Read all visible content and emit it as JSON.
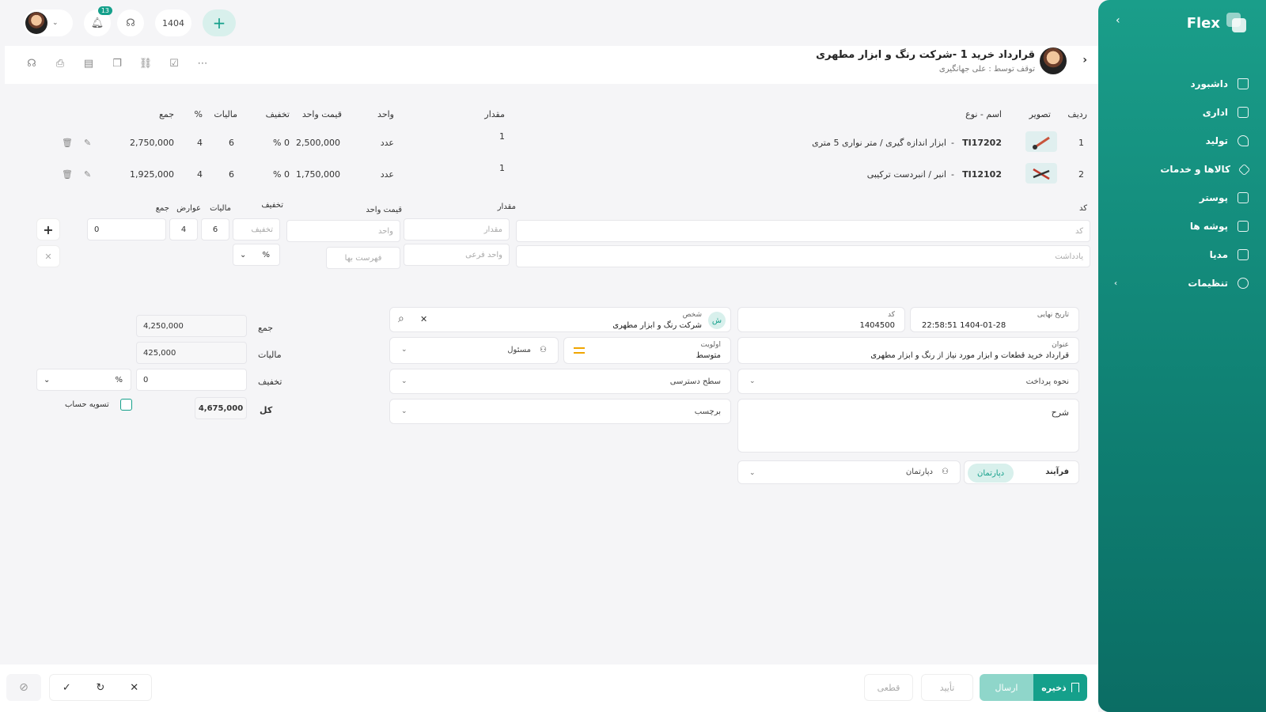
{
  "sidebar": {
    "brand": "Flex",
    "items": [
      {
        "label": "داشبورد"
      },
      {
        "label": "اداری"
      },
      {
        "label": "تولید"
      },
      {
        "label": "کالاها و خدمات"
      },
      {
        "label": "پوستر"
      },
      {
        "label": "پوشه ها"
      },
      {
        "label": "مدیا"
      },
      {
        "label": "تنظیمات"
      }
    ]
  },
  "topbar": {
    "notifications": "13",
    "year": "1404"
  },
  "header": {
    "title": "قرارداد خرید 1 -شرکت رنگ و ابزار مطهری",
    "subtitle": "توقف توسط : علی جهانگیری"
  },
  "table": {
    "headers": {
      "row": "ردیف",
      "image": "تصویر",
      "name": "اسم - نوع",
      "qty": "مقدار",
      "unit": "واحد",
      "price": "قیمت واحد",
      "discount": "تخفیف",
      "tax": "مالیات",
      "pct": "%",
      "total": "جمع"
    },
    "rows": [
      {
        "idx": "1",
        "code": "TI17202",
        "name": "ابزار اندازه گیری / متر نواری 5 متری",
        "qty": "1",
        "unit": "عدد",
        "price": "2,500,000",
        "discount": "0 %",
        "tax": "6",
        "pct": "4",
        "total": "2,750,000"
      },
      {
        "idx": "2",
        "code": "TI12102",
        "name": "انبر / انبردست ترکیبی",
        "qty": "1",
        "unit": "عدد",
        "price": "1,750,000",
        "discount": "0 %",
        "tax": "6",
        "pct": "4",
        "total": "1,925,000"
      }
    ]
  },
  "entry": {
    "code_label": "کد",
    "qty_label": "مقدار",
    "price_label": "قیمت واحد",
    "discount_label": "تخفیف",
    "tax_label": "مالیات",
    "duties_label": "عوارض",
    "total_label": "جمع",
    "code_ph": "کد",
    "note_ph": "یادداشت",
    "qty_ph": "مقدار",
    "subunit_ph": "واحد فرعی",
    "unit_ph": "واحد",
    "pricelist_ph": "فهرست بها",
    "discount_ph": "تخفیف",
    "pct_select": "%",
    "tax_value": "6",
    "duties_value": "4",
    "total_value": "0"
  },
  "form": {
    "deadline_label": "تاریخ نهایی",
    "deadline_value": "1404-01-28 22:58:51",
    "code_label": "کد",
    "code_value": "1404500",
    "person_label": "شخص",
    "person_value": "شرکت رنگ و ابزار مطهری",
    "person_initial": "ش",
    "subject_label": "عنوان",
    "subject_value": "قرارداد خرید قطعات و ابزار مورد نیاز از رنگ و ابزار مطهری",
    "priority_label": "اولویت",
    "priority_value": "متوسط",
    "owner_ph": "مسئول",
    "payment_ph": "نحوه پرداخت",
    "access_ph": "سطح دسترسی",
    "desc_label": "شرح",
    "tag_ph": "برچسب",
    "process_label": "فرآیند",
    "dept_chip": "دپارتمان",
    "dept_ph": "دپارتمان"
  },
  "summary": {
    "sum_label": "جمع",
    "sum_value": "4,250,000",
    "tax_label": "مالیات",
    "tax_value": "425,000",
    "discount_label": "تخفیف",
    "discount_value": "0",
    "discount_unit": "%",
    "total_label": "کل",
    "total_value": "4,675,000",
    "settle_label": "تسویه حساب"
  },
  "footer": {
    "save": "ذخیره",
    "send": "ارسال",
    "approve": "تأیید",
    "final": "قطعی"
  },
  "colors": {
    "accent": "#15a08b",
    "sidebar": "#0f7f72"
  }
}
